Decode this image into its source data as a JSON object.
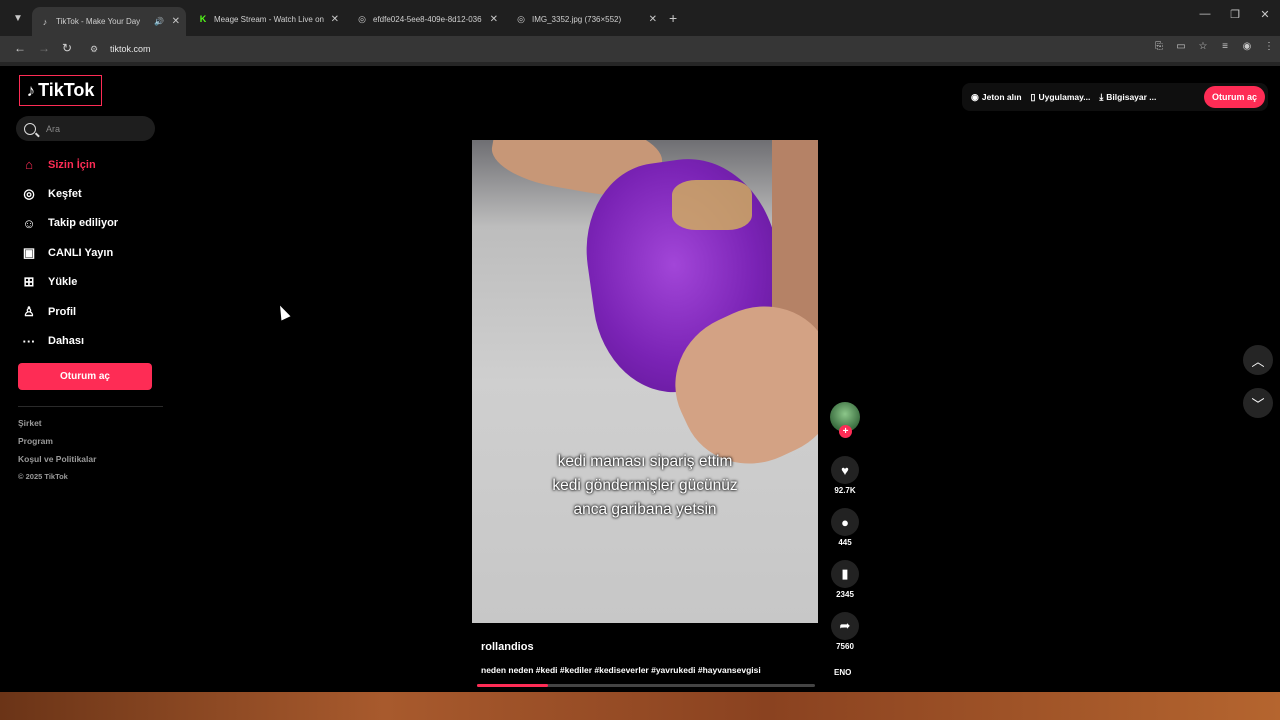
{
  "browser": {
    "tabs": [
      {
        "title": "TikTok - Make Your Day",
        "favicon": "tiktok-icon",
        "active": true,
        "audio": true
      },
      {
        "title": "Meage Stream - Watch Live on",
        "favicon": "kick-icon",
        "active": false
      },
      {
        "title": "efdfe024-5ee8-409e-8d12-036",
        "favicon": "globe-icon",
        "active": false
      },
      {
        "title": "IMG_3352.jpg (736×552)",
        "favicon": "globe-icon",
        "active": false
      }
    ],
    "url": "tiktok.com"
  },
  "tiktok": {
    "logo_text": "TikTok",
    "search_placeholder": "Ara",
    "nav": [
      {
        "label": "Sizin İçin",
        "icon": "home-icon",
        "active": true
      },
      {
        "label": "Keşfet",
        "icon": "compass-icon",
        "active": false
      },
      {
        "label": "Takip ediliyor",
        "icon": "following-icon",
        "active": false
      },
      {
        "label": "CANLI Yayın",
        "icon": "live-icon",
        "active": false
      },
      {
        "label": "Yükle",
        "icon": "upload-icon",
        "active": false
      },
      {
        "label": "Profil",
        "icon": "profile-icon",
        "active": false
      },
      {
        "label": "Dahası",
        "icon": "more-icon",
        "active": false
      }
    ],
    "login_button": "Oturum aç",
    "footer": {
      "links": [
        "Şirket",
        "Program",
        "Koşul ve Politikalar"
      ],
      "copyright": "© 2025 TikTok"
    },
    "top_bar": {
      "coins": "Jeton alın",
      "app": "Uygulamay...",
      "computer": "Bilgisayar ...",
      "login": "Oturum aç"
    },
    "video": {
      "caption": [
        "kedi maması sipariş ettim",
        "kedi göndermişler gücünüz",
        "anca garibana yetsin"
      ],
      "author": "rollandios",
      "description": "neden neden #kedi #kediler #kediseverler #yavrukedi #hayvansevgisi",
      "progress": 0.21
    },
    "actions": {
      "likes": "92.7K",
      "comments": "445",
      "saves": "2345",
      "shares": "7560",
      "music_tag": "ENO"
    }
  },
  "colors": {
    "accent": "#fe2c55"
  }
}
